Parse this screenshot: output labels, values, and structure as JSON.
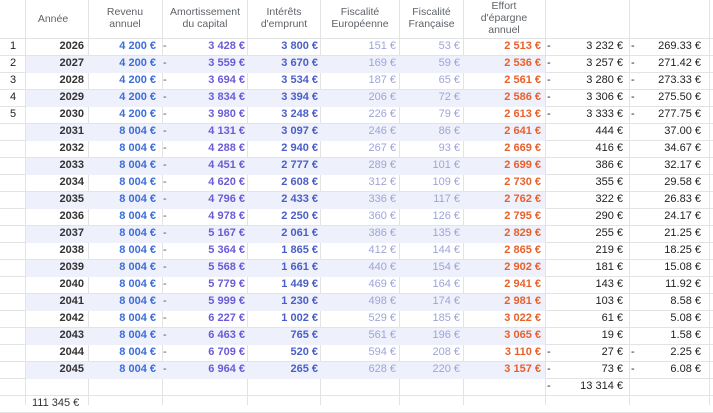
{
  "headers": {
    "annee": "Année",
    "revenu": "Revenu\nannuel",
    "amortissement": "Amortissement\ndu capital",
    "interets": "Intérêts\nd'emprunt",
    "fisc_eu": "Fiscalité\nEuropéenne",
    "fisc_fr": "Fiscalité\nFrançaise",
    "effort": "Effort\nd'épargne\nannuel"
  },
  "rows": [
    {
      "n": "1",
      "year": "2026",
      "rev": "4 200 €",
      "d1": "-",
      "amort": "3 428 €",
      "int": "3 800 €",
      "eu": "151 €",
      "fr": "53 €",
      "eff": "2 513 €",
      "d2": "-",
      "c8": "3 232 €",
      "d3": "-",
      "c9": "269.33 €"
    },
    {
      "n": "2",
      "year": "2027",
      "rev": "4 200 €",
      "d1": "-",
      "amort": "3 559 €",
      "int": "3 670 €",
      "eu": "169 €",
      "fr": "59 €",
      "eff": "2 536 €",
      "d2": "-",
      "c8": "3 257 €",
      "d3": "-",
      "c9": "271.42 €"
    },
    {
      "n": "3",
      "year": "2028",
      "rev": "4 200 €",
      "d1": "-",
      "amort": "3 694 €",
      "int": "3 534 €",
      "eu": "187 €",
      "fr": "65 €",
      "eff": "2 561 €",
      "d2": "-",
      "c8": "3 280 €",
      "d3": "-",
      "c9": "273.33 €"
    },
    {
      "n": "4",
      "year": "2029",
      "rev": "4 200 €",
      "d1": "-",
      "amort": "3 834 €",
      "int": "3 394 €",
      "eu": "206 €",
      "fr": "72 €",
      "eff": "2 586 €",
      "d2": "-",
      "c8": "3 306 €",
      "d3": "-",
      "c9": "275.50 €"
    },
    {
      "n": "5",
      "year": "2030",
      "rev": "4 200 €",
      "d1": "-",
      "amort": "3 980 €",
      "int": "3 248 €",
      "eu": "226 €",
      "fr": "79 €",
      "eff": "2 613 €",
      "d2": "-",
      "c8": "3 333 €",
      "d3": "-",
      "c9": "277.75 €"
    },
    {
      "n": "",
      "year": "2031",
      "rev": "8 004 €",
      "d1": "-",
      "amort": "4 131 €",
      "int": "3 097 €",
      "eu": "246 €",
      "fr": "86 €",
      "eff": "2 641 €",
      "d2": "",
      "c8": "444 €",
      "d3": "",
      "c9": "37.00 €"
    },
    {
      "n": "",
      "year": "2032",
      "rev": "8 004 €",
      "d1": "-",
      "amort": "4 288 €",
      "int": "2 940 €",
      "eu": "267 €",
      "fr": "93 €",
      "eff": "2 669 €",
      "d2": "",
      "c8": "416 €",
      "d3": "",
      "c9": "34.67 €"
    },
    {
      "n": "",
      "year": "2033",
      "rev": "8 004 €",
      "d1": "-",
      "amort": "4 451 €",
      "int": "2 777 €",
      "eu": "289 €",
      "fr": "101 €",
      "eff": "2 699 €",
      "d2": "",
      "c8": "386 €",
      "d3": "",
      "c9": "32.17 €"
    },
    {
      "n": "",
      "year": "2034",
      "rev": "8 004 €",
      "d1": "-",
      "amort": "4 620 €",
      "int": "2 608 €",
      "eu": "312 €",
      "fr": "109 €",
      "eff": "2 730 €",
      "d2": "",
      "c8": "355 €",
      "d3": "",
      "c9": "29.58 €"
    },
    {
      "n": "",
      "year": "2035",
      "rev": "8 004 €",
      "d1": "-",
      "amort": "4 796 €",
      "int": "2 433 €",
      "eu": "336 €",
      "fr": "117 €",
      "eff": "2 762 €",
      "d2": "",
      "c8": "322 €",
      "d3": "",
      "c9": "26.83 €"
    },
    {
      "n": "",
      "year": "2036",
      "rev": "8 004 €",
      "d1": "-",
      "amort": "4 978 €",
      "int": "2 250 €",
      "eu": "360 €",
      "fr": "126 €",
      "eff": "2 795 €",
      "d2": "",
      "c8": "290 €",
      "d3": "",
      "c9": "24.17 €"
    },
    {
      "n": "",
      "year": "2037",
      "rev": "8 004 €",
      "d1": "-",
      "amort": "5 167 €",
      "int": "2 061 €",
      "eu": "386 €",
      "fr": "135 €",
      "eff": "2 829 €",
      "d2": "",
      "c8": "255 €",
      "d3": "",
      "c9": "21.25 €"
    },
    {
      "n": "",
      "year": "2038",
      "rev": "8 004 €",
      "d1": "-",
      "amort": "5 364 €",
      "int": "1 865 €",
      "eu": "412 €",
      "fr": "144 €",
      "eff": "2 865 €",
      "d2": "",
      "c8": "219 €",
      "d3": "",
      "c9": "18.25 €"
    },
    {
      "n": "",
      "year": "2039",
      "rev": "8 004 €",
      "d1": "-",
      "amort": "5 568 €",
      "int": "1 661 €",
      "eu": "440 €",
      "fr": "154 €",
      "eff": "2 902 €",
      "d2": "",
      "c8": "181 €",
      "d3": "",
      "c9": "15.08 €"
    },
    {
      "n": "",
      "year": "2040",
      "rev": "8 004 €",
      "d1": "-",
      "amort": "5 779 €",
      "int": "1 449 €",
      "eu": "469 €",
      "fr": "164 €",
      "eff": "2 941 €",
      "d2": "",
      "c8": "143 €",
      "d3": "",
      "c9": "11.92 €"
    },
    {
      "n": "",
      "year": "2041",
      "rev": "8 004 €",
      "d1": "-",
      "amort": "5 999 €",
      "int": "1 230 €",
      "eu": "498 €",
      "fr": "174 €",
      "eff": "2 981 €",
      "d2": "",
      "c8": "103 €",
      "d3": "",
      "c9": "8.58 €"
    },
    {
      "n": "",
      "year": "2042",
      "rev": "8 004 €",
      "d1": "-",
      "amort": "6 227 €",
      "int": "1 002 €",
      "eu": "529 €",
      "fr": "185 €",
      "eff": "3 022 €",
      "d2": "",
      "c8": "61 €",
      "d3": "",
      "c9": "5.08 €"
    },
    {
      "n": "",
      "year": "2043",
      "rev": "8 004 €",
      "d1": "-",
      "amort": "6 463 €",
      "int": "765 €",
      "eu": "561 €",
      "fr": "196 €",
      "eff": "3 065 €",
      "d2": "",
      "c8": "19 €",
      "d3": "",
      "c9": "1.58 €"
    },
    {
      "n": "",
      "year": "2044",
      "rev": "8 004 €",
      "d1": "-",
      "amort": "6 709 €",
      "int": "520 €",
      "eu": "594 €",
      "fr": "208 €",
      "eff": "3 110 €",
      "d2": "-",
      "c8": "27 €",
      "d3": "-",
      "c9": "2.25 €"
    },
    {
      "n": "",
      "year": "2045",
      "rev": "8 004 €",
      "d1": "-",
      "amort": "6 964 €",
      "int": "265 €",
      "eu": "628 €",
      "fr": "220 €",
      "eff": "3 157 €",
      "d2": "-",
      "c8": "73 €",
      "d3": "-",
      "c9": "6.08 €"
    }
  ],
  "total": {
    "d2": "-",
    "c8": "13 314 €"
  },
  "bottom_text": "111 345 €"
}
